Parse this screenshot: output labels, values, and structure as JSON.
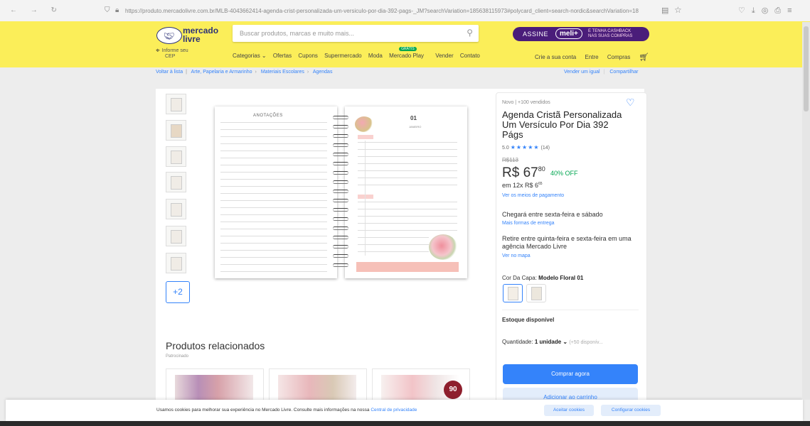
{
  "browser": {
    "url": "https://produto.mercadolivre.com.br/MLB-4043662414-agenda-crist-personalizada-um-versiculo-por-dia-392-pags-_JM?searchVariation=185638115973#polycard_client=search-nordic&searchVariation=18",
    "url_host": "mercadolivre.com.br"
  },
  "header": {
    "logo_line1": "mercado",
    "logo_line2": "livre",
    "cep_line1": "Informe seu",
    "cep_line2": "CEP",
    "search_placeholder": "Buscar produtos, marcas e muito mais...",
    "meli_assine": "ASSINE",
    "meli_brand": "meli+",
    "meli_cashback_1": "E TENHA CASHBACK",
    "meli_cashback_2": "NAS SUAS COMPRAS",
    "nav": [
      "Categorias ⌄",
      "Ofertas",
      "Cupons",
      "Supermercado",
      "Moda",
      "Mercado Play",
      "Vender",
      "Contato"
    ],
    "new_tag": "GRÁTIS",
    "user_links": [
      "Crie a sua conta",
      "Entre",
      "Compras"
    ]
  },
  "breadcrumb": {
    "back": "Voltar à lista",
    "items": [
      "Arte, Papelaria e Armarinho",
      "Materiais Escolares",
      "Agendas"
    ],
    "sell_similar": "Vender um igual",
    "share": "Compartilhar"
  },
  "gallery": {
    "more_label": "+2",
    "left_page_title": "ANOTAÇÕES",
    "right_page_number": "01",
    "right_page_month": "JANEIRO"
  },
  "product": {
    "condition": "Novo  |  +100 vendidos",
    "title": "Agenda Cristã Personalizada Um Versículo Por Dia 392 Págs",
    "rating_value": "5.0",
    "stars": "★★★★★",
    "rating_count": "(14)",
    "old_price": "R$113",
    "price_main": "R$ 67",
    "price_cents": "80",
    "discount": "40% OFF",
    "installments": "em 12x R$ 6",
    "installments_cents": "65",
    "payment_link": "Ver os meios de pagamento",
    "delivery": "Chegará entre sexta-feira e sábado",
    "delivery_link": "Mais formas de entrega",
    "pickup": "Retire entre quinta-feira e sexta-feira em uma agência Mercado Livre",
    "pickup_link": "Ver no mapa",
    "color_label": "Cor Da Capa:",
    "color_value": "Modelo Floral 01",
    "stock": "Estoque disponível",
    "qty_label": "Quantidade:",
    "qty_value": "1 unidade ⌄",
    "qty_available": "(+50 disponív...",
    "buy_now": "Comprar agora",
    "add_cart": "Adicionar ao carrinho"
  },
  "related": {
    "title": "Produtos relacionados",
    "sponsored": "Patrocinado",
    "badge": "90"
  },
  "cookies": {
    "text": "Usamos cookies para melhorar sua experiência no Mercado Livre. Consulte mais informações na nossa",
    "link": "Central de privacidade",
    "accept": "Aceitar cookies",
    "configure": "Configurar cookies"
  }
}
